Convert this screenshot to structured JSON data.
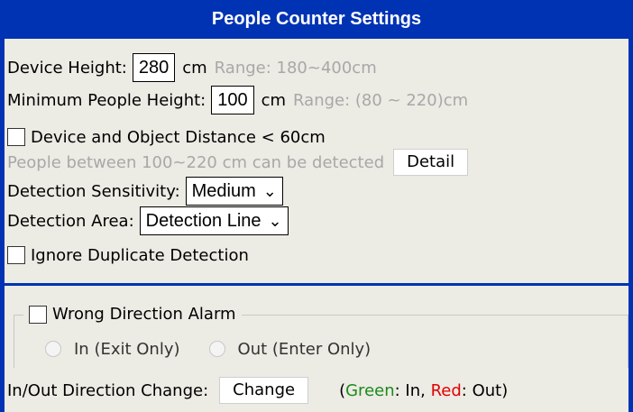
{
  "header": {
    "title": "People Counter Settings"
  },
  "device_height": {
    "label": "Device Height:",
    "value": "280",
    "unit": "cm",
    "range": "Range: 180~400cm"
  },
  "min_people_height": {
    "label": "Minimum People Height:",
    "value": "100",
    "unit": "cm",
    "range": "Range: (80 ~ 220)cm"
  },
  "distance_checkbox": {
    "label": "Device and Object Distance < 60cm",
    "checked": false
  },
  "detect_note": {
    "text": "People between 100~220 cm can be detected",
    "button": "Detail"
  },
  "sensitivity": {
    "label": "Detection Sensitivity:",
    "value": "Medium"
  },
  "area": {
    "label": "Detection Area:",
    "value": "Detection Line"
  },
  "ignore_dup": {
    "label": "Ignore Duplicate Detection",
    "checked": false
  },
  "wrong_direction": {
    "label": "Wrong Direction Alarm",
    "checked": false,
    "options": [
      {
        "label": "In (Exit Only)"
      },
      {
        "label": "Out (Enter Only)"
      }
    ]
  },
  "direction_change": {
    "label": "In/Out Direction Change:",
    "button": "Change",
    "legend_open": "(",
    "green_word": "Green",
    "green_suffix": ": In, ",
    "red_word": "Red",
    "red_suffix": ": Out)"
  },
  "colors": {
    "header_bg": "#0033b3",
    "panel_bg": "#ecebe4",
    "green": "#1b8a1b",
    "red": "#e20000"
  }
}
